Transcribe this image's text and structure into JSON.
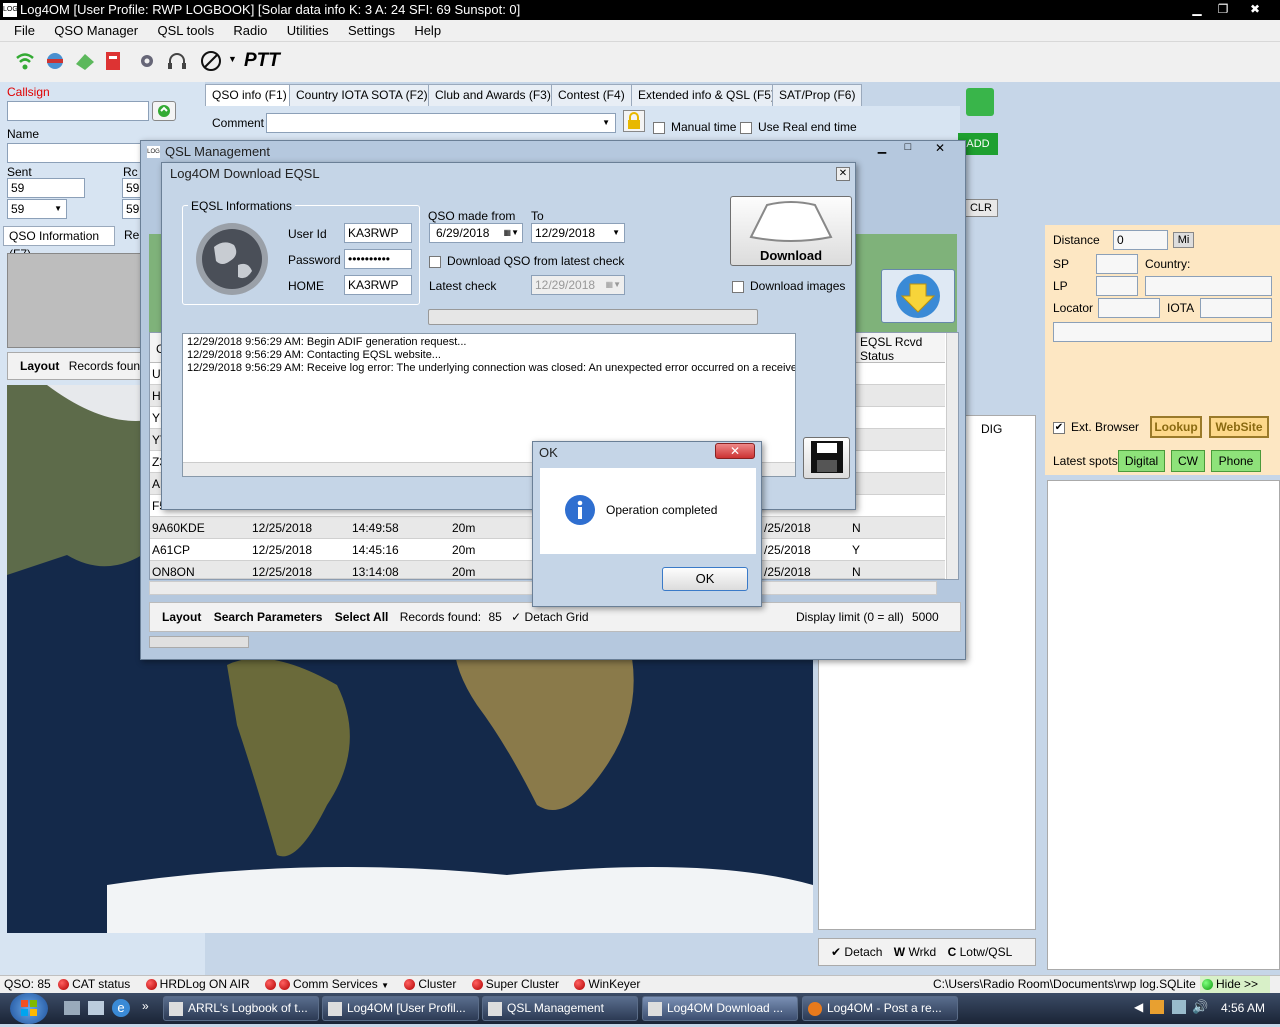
{
  "app": {
    "title": "Log4OM [User Profile: RWP LOGBOOK] [Solar data info K: 3 A: 24 SFI: 69 Sunspot: 0]",
    "icon_text": "LOG4OM"
  },
  "window_controls": [
    "minimize-icon",
    "restore-icon",
    "close-icon"
  ],
  "menu": [
    "File",
    "QSO Manager",
    "QSL tools",
    "Radio",
    "Utilities",
    "Settings",
    "Help"
  ],
  "toolbar": {
    "ptt_label": "PTT"
  },
  "left": {
    "callsign_label": "Callsign",
    "name_label": "Name",
    "sent_label": "Sent",
    "rcvd_label": "Rc",
    "sent_value": "59",
    "sent_select": "59",
    "rcvd_value": "59",
    "rcvd_select": "59",
    "tab_qso_info": "QSO Information (F7)",
    "tab_re": "Re",
    "layout_label": "Layout",
    "records_found_label": "Records foun"
  },
  "tabs": [
    "QSO info (F1)",
    "Country IOTA SOTA (F2)",
    "Club and Awards (F3)",
    "Contest (F4)",
    "Extended info & QSL (F5)",
    "SAT/Prop (F6)"
  ],
  "qso_info": {
    "comment_label": "Comment",
    "manual_time_label": "Manual time",
    "real_end_time_label": "Use Real end time",
    "add_label": "ADD",
    "clr_label": "CLR"
  },
  "right_panel": {
    "distance_label": "Distance",
    "distance_value": "0",
    "unit_button": "Mi",
    "sp_label": "SP",
    "country_label": "Country:",
    "lp_label": "LP",
    "locator_label": "Locator",
    "iota_label": "IOTA",
    "ext_browser_label": "Ext. Browser",
    "lookup_button": "Lookup",
    "website_button": "WebSite",
    "latest_spots_label": "Latest spots",
    "spot_buttons": [
      "Digital",
      "CW",
      "Phone"
    ],
    "dig_header": "DIG",
    "detach_label": "Detach",
    "w_label": "W",
    "wrkd_label": "Wrkd",
    "c_label": "C",
    "lotw_label": "Lotw/QSL"
  },
  "qsl_management": {
    "title": "QSL Management",
    "eqsl_header": "EQSL Rcvd",
    "status_header": "Status",
    "left_col_partial": [
      "UT",
      "HG",
      "YP",
      "YT",
      "Z3",
      "AE",
      "F5"
    ],
    "left_col_header": "C",
    "rows": [
      {
        "call": "9A60KDE",
        "date": "12/25/2018",
        "time": "14:49:58",
        "band": "20m",
        "qsl_date": "/25/2018",
        "status": "N"
      },
      {
        "call": "A61CP",
        "date": "12/25/2018",
        "time": "14:45:16",
        "band": "20m",
        "qsl_date": "/25/2018",
        "status": "Y"
      },
      {
        "call": "ON8ON",
        "date": "12/25/2018",
        "time": "13:14:08",
        "band": "20m",
        "qsl_date": "/25/2018",
        "status": "N"
      }
    ],
    "footer": {
      "layout": "Layout",
      "search_parameters": "Search Parameters",
      "select_all": "Select All",
      "records_found_label": "Records found:",
      "records_found_value": "85",
      "detach_grid": "Detach Grid",
      "display_limit_label": "Display limit (0 = all)",
      "display_limit_value": "5000"
    }
  },
  "download_eqsl": {
    "title": "Log4OM Download EQSL",
    "group_label": "EQSL Informations",
    "user_id_label": "User Id",
    "user_id_value": "KA3RWP",
    "password_label": "Password",
    "password_value": "••••••••••",
    "home_label": "HOME",
    "home_value": "KA3RWP",
    "qso_from_label": "QSO made from",
    "qso_from_value": "6/29/2018",
    "to_label": "To",
    "to_value": "12/29/2018",
    "download_from_latest_label": "Download QSO from latest check",
    "latest_check_label": "Latest check",
    "latest_check_value": "12/29/2018",
    "download_button": "Download",
    "download_images_label": "Download images",
    "log_lines": [
      "12/29/2018 9:56:29 AM: Begin ADIF generation request...",
      "12/29/2018 9:56:29 AM: Contacting EQSL website...",
      "12/29/2018 9:56:29 AM: Receive log error: The underlying connection was closed: An unexpected error occurred on a receive."
    ]
  },
  "dialog": {
    "title": "OK",
    "message": "Operation completed",
    "ok_button": "OK"
  },
  "statusbar": {
    "qso_label": "QSO:",
    "qso_count": "85",
    "cat_status": "CAT status",
    "hrdlog": "HRDLog ON AIR",
    "comm_services": "Comm Services",
    "cluster": "Cluster",
    "super_cluster": "Super Cluster",
    "winkeyer": "WinKeyer",
    "db_path": "C:\\Users\\Radio Room\\Documents\\rwp log.SQLite",
    "hide": "Hide >>"
  },
  "taskbar": {
    "tasks": [
      "ARRL's Logbook of t...",
      "Log4OM [User Profil...",
      "QSL Management",
      "Log4OM Download ...",
      "Log4OM - Post a re..."
    ],
    "clock": "4:56 AM"
  },
  "colors": {
    "accent_green": "#8ee27a",
    "callsign_red": "#e00000",
    "lookup_brown": "#8a6a10",
    "map_blue": "#14294a"
  }
}
